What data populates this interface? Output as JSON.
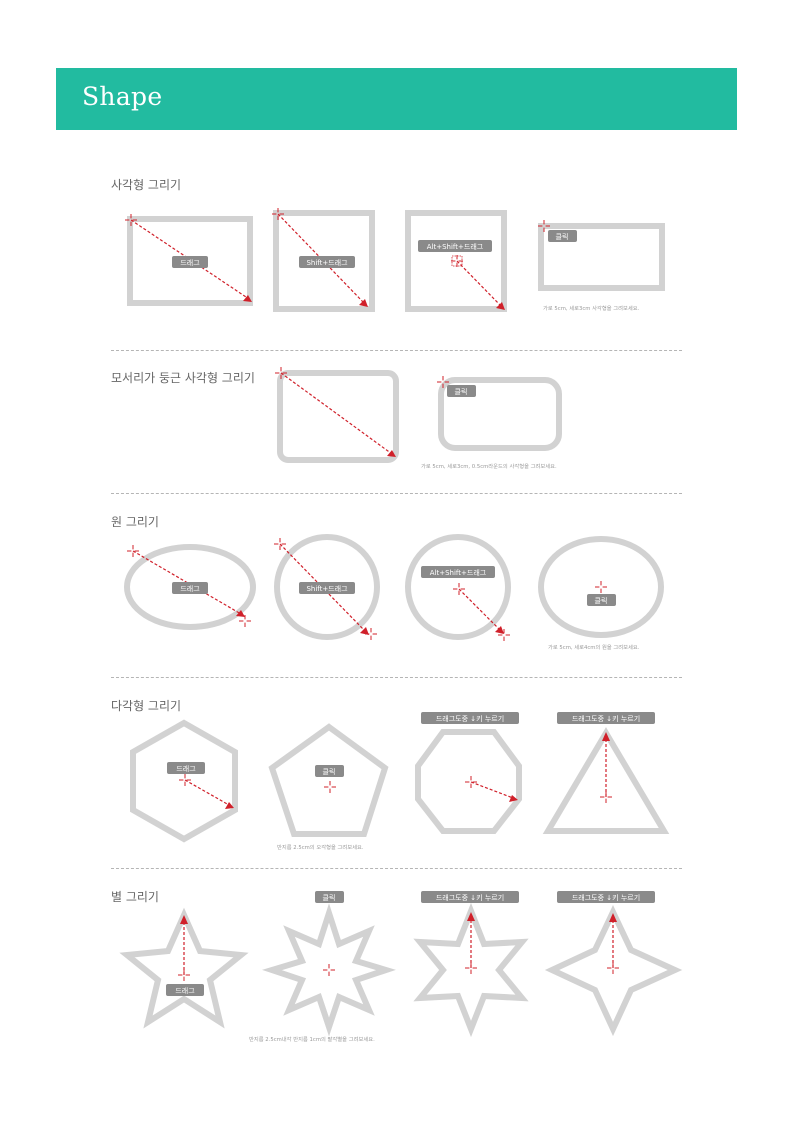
{
  "page": {
    "title": "Shape"
  },
  "colors": {
    "banner": "#22bba0",
    "shape_stroke": "#d2d2d2",
    "arrow": "#d0202a",
    "label_bg": "#8a8a8a"
  },
  "sections": {
    "rect": {
      "title": "사각형 그리기",
      "labels": [
        "드래그",
        "Shift+드래그",
        "Alt+Shift+드래그",
        "클릭"
      ],
      "note": "가로 5cm, 세로3cm 사각형을 그려보세요."
    },
    "rounded": {
      "title": "모서리가 둥근 사각형 그리기",
      "labels": [
        "클릭"
      ],
      "note": "가로 5cm, 세로3cm, 0.5cm라운드의 사각형을 그려보세요."
    },
    "circle": {
      "title": "원 그리기",
      "labels": [
        "드래그",
        "Shift+드래그",
        "Alt+Shift+드래그",
        "클릭"
      ],
      "note": "가로 5cm, 세로4cm의 원을 그려보세요."
    },
    "polygon": {
      "title": "다각형 그리기",
      "labels": [
        "드래그",
        "클릭",
        "드래그도중 ↓키 누르기",
        "드래그도중 ↓키 누르기"
      ],
      "note": "반지름 2.5cm의 오각형을 그려보세요."
    },
    "star": {
      "title": "별 그리기",
      "labels": [
        "드래그",
        "클릭",
        "드래그도중 ↓키 누르기",
        "드래그도중 ↓키 누르기"
      ],
      "note": "반지름 2.5cm내각 반지름 1cm의 팔각별을 그려보세요."
    }
  }
}
